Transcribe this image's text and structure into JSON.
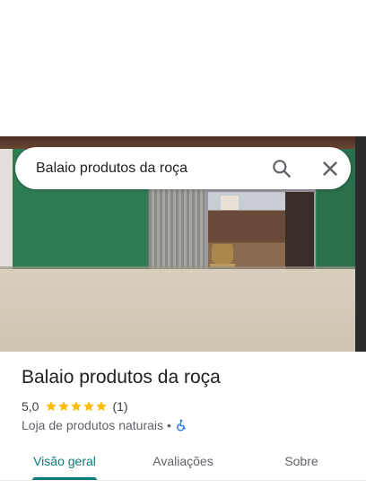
{
  "search": {
    "value": "Balaio produtos da roça",
    "search_icon": "search-icon",
    "clear_icon": "close-icon"
  },
  "place": {
    "name": "Balaio produtos da roça",
    "rating": "5,0",
    "stars": 5,
    "review_count": "(1)",
    "category": "Loja de produtos naturais",
    "separator": "•",
    "accessibility_icon": "wheelchair-icon"
  },
  "tabs": [
    {
      "label": "Visão geral",
      "active": true
    },
    {
      "label": "Avaliações",
      "active": false
    },
    {
      "label": "Sobre",
      "active": false
    }
  ],
  "colors": {
    "accent": "#0b7a7a",
    "star": "#fbbc04",
    "accessibility": "#1a73e8"
  }
}
